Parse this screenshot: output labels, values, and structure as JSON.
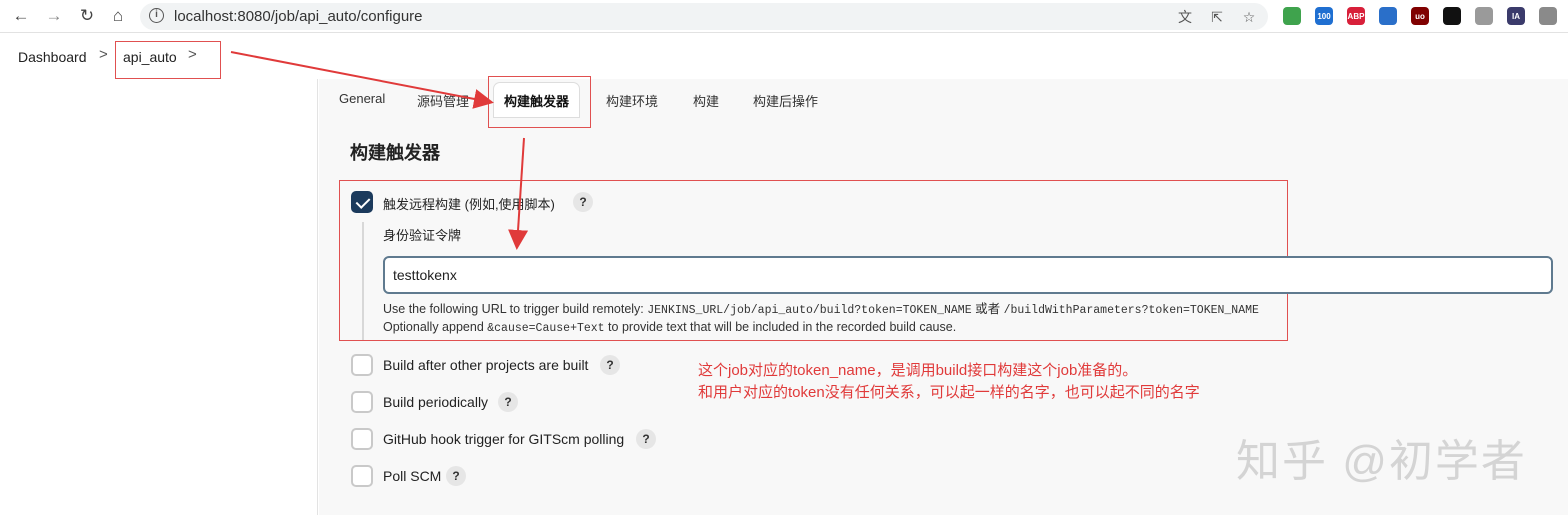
{
  "browser": {
    "url": "localhost:8080/job/api_auto/configure",
    "extensions": [
      {
        "name": "adguard-icon",
        "color": "#3fa34d",
        "text": ""
      },
      {
        "name": "counter-icon",
        "color": "#1f6fd1",
        "text": "100"
      },
      {
        "name": "adblock-plus-icon",
        "color": "#d8203a",
        "text": "ABP"
      },
      {
        "name": "hopper-icon",
        "color": "#2a6fc9",
        "text": ""
      },
      {
        "name": "ublock-icon",
        "color": "#800000",
        "text": "uo"
      },
      {
        "name": "key-icon",
        "color": "#111111",
        "text": ""
      },
      {
        "name": "feather-icon",
        "color": "#9a9a9a",
        "text": ""
      },
      {
        "name": "ia-icon",
        "color": "#3b3b6b",
        "text": "IA"
      },
      {
        "name": "image-icon",
        "color": "#8a8a8a",
        "text": ""
      }
    ]
  },
  "breadcrumb": {
    "dashboard": "Dashboard",
    "job": "api_auto",
    "separator": ">"
  },
  "tabs": [
    {
      "label": "General"
    },
    {
      "label": "源码管理"
    },
    {
      "label": "构建触发器",
      "active": true
    },
    {
      "label": "构建环境"
    },
    {
      "label": "构建"
    },
    {
      "label": "构建后操作"
    }
  ],
  "section": {
    "title": "构建触发器"
  },
  "remote_trigger": {
    "label": "触发远程构建 (例如,使用脚本)",
    "checked": true,
    "token_label": "身份验证令牌",
    "token_value": "testtokenx",
    "hint1_prefix": "Use the following URL to trigger build remotely: ",
    "hint1_url": "JENKINS_URL/job/api_auto/build?token=TOKEN_NAME",
    "hint1_or": " 或者 ",
    "hint1_url2": "/buildWithParameters?token=TOKEN_NAME",
    "hint2_prefix": "Optionally append ",
    "hint2_code": "&cause=Cause+Text",
    "hint2_suffix": " to provide text that will be included in the recorded build cause."
  },
  "triggers": [
    {
      "label": "Build after other projects are built",
      "checked": false
    },
    {
      "label": "Build periodically",
      "checked": false
    },
    {
      "label": "GitHub hook trigger for GITScm polling",
      "checked": false
    },
    {
      "label": "Poll SCM",
      "checked": false
    }
  ],
  "help_mark": "?",
  "annotation": {
    "line1": "这个job对应的token_name，是调用build接口构建这个job准备的。",
    "line2": "和用户对应的token没有任何关系，可以起一样的名字，也可以起不同的名字",
    "color": "#e03a3a"
  },
  "watermark": "知乎 @初学者"
}
